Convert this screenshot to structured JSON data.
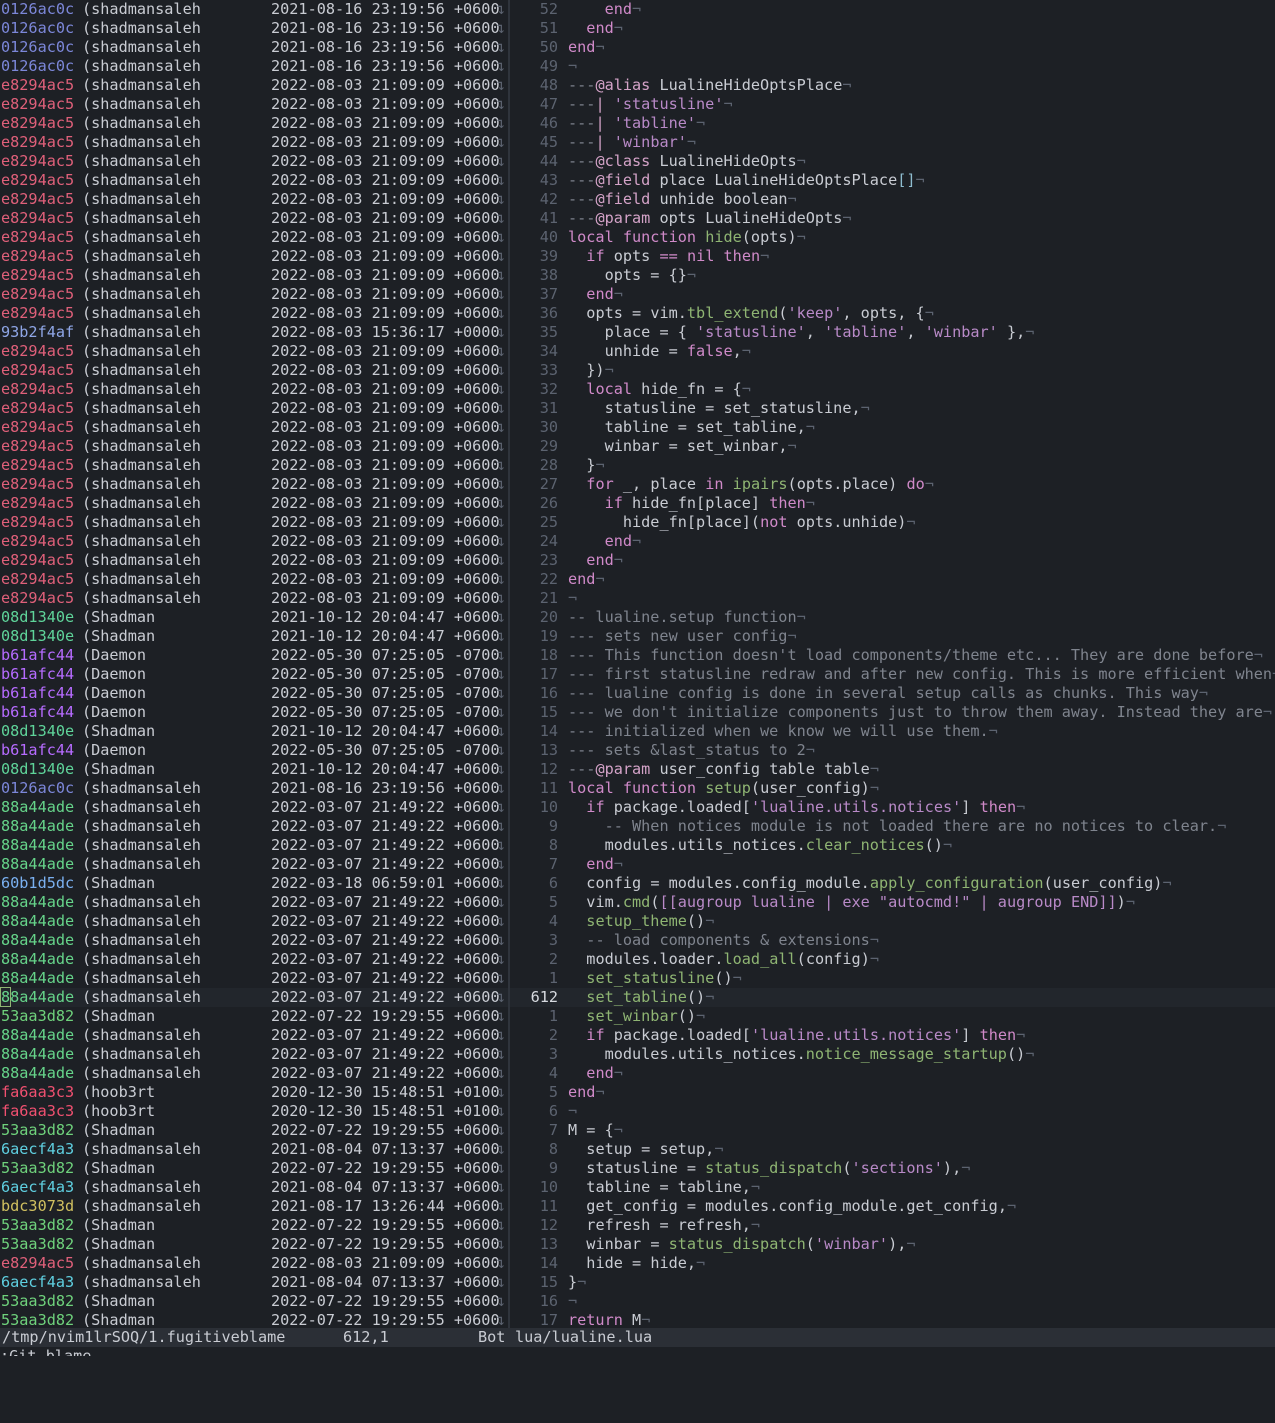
{
  "colors": {
    "hashes": {
      "0126ac0c": "#7c87d9",
      "e8294ac5": "#e0607a",
      "93b2f4af": "#8fa6e6",
      "08d1340e": "#5fd49a",
      "b61afc44": "#b66bff",
      "88a44ade": "#66d48a",
      "60b1d5dc": "#7ab0f0",
      "53aa3d82": "#6fd27c",
      "fa6aa3c3": "#f05070",
      "6aecf4a3": "#5fcfe0",
      "bdc3073d": "#d0c060"
    }
  },
  "blame_marker": "↴",
  "code_eol_marker": "¬",
  "blame_rows": [
    {
      "hash": "0126ac0c",
      "author": "(shadmansaleh",
      "date": "2021-08-16 23:19:56 +0600"
    },
    {
      "hash": "0126ac0c",
      "author": "(shadmansaleh",
      "date": "2021-08-16 23:19:56 +0600"
    },
    {
      "hash": "0126ac0c",
      "author": "(shadmansaleh",
      "date": "2021-08-16 23:19:56 +0600"
    },
    {
      "hash": "0126ac0c",
      "author": "(shadmansaleh",
      "date": "2021-08-16 23:19:56 +0600"
    },
    {
      "hash": "e8294ac5",
      "author": "(shadmansaleh",
      "date": "2022-08-03 21:09:09 +0600"
    },
    {
      "hash": "e8294ac5",
      "author": "(shadmansaleh",
      "date": "2022-08-03 21:09:09 +0600"
    },
    {
      "hash": "e8294ac5",
      "author": "(shadmansaleh",
      "date": "2022-08-03 21:09:09 +0600"
    },
    {
      "hash": "e8294ac5",
      "author": "(shadmansaleh",
      "date": "2022-08-03 21:09:09 +0600"
    },
    {
      "hash": "e8294ac5",
      "author": "(shadmansaleh",
      "date": "2022-08-03 21:09:09 +0600"
    },
    {
      "hash": "e8294ac5",
      "author": "(shadmansaleh",
      "date": "2022-08-03 21:09:09 +0600"
    },
    {
      "hash": "e8294ac5",
      "author": "(shadmansaleh",
      "date": "2022-08-03 21:09:09 +0600"
    },
    {
      "hash": "e8294ac5",
      "author": "(shadmansaleh",
      "date": "2022-08-03 21:09:09 +0600"
    },
    {
      "hash": "e8294ac5",
      "author": "(shadmansaleh",
      "date": "2022-08-03 21:09:09 +0600"
    },
    {
      "hash": "e8294ac5",
      "author": "(shadmansaleh",
      "date": "2022-08-03 21:09:09 +0600"
    },
    {
      "hash": "e8294ac5",
      "author": "(shadmansaleh",
      "date": "2022-08-03 21:09:09 +0600"
    },
    {
      "hash": "e8294ac5",
      "author": "(shadmansaleh",
      "date": "2022-08-03 21:09:09 +0600"
    },
    {
      "hash": "e8294ac5",
      "author": "(shadmansaleh",
      "date": "2022-08-03 21:09:09 +0600"
    },
    {
      "hash": "93b2f4af",
      "author": "(shadmansaleh",
      "date": "2022-08-03 15:36:17 +0000"
    },
    {
      "hash": "e8294ac5",
      "author": "(shadmansaleh",
      "date": "2022-08-03 21:09:09 +0600"
    },
    {
      "hash": "e8294ac5",
      "author": "(shadmansaleh",
      "date": "2022-08-03 21:09:09 +0600"
    },
    {
      "hash": "e8294ac5",
      "author": "(shadmansaleh",
      "date": "2022-08-03 21:09:09 +0600"
    },
    {
      "hash": "e8294ac5",
      "author": "(shadmansaleh",
      "date": "2022-08-03 21:09:09 +0600"
    },
    {
      "hash": "e8294ac5",
      "author": "(shadmansaleh",
      "date": "2022-08-03 21:09:09 +0600"
    },
    {
      "hash": "e8294ac5",
      "author": "(shadmansaleh",
      "date": "2022-08-03 21:09:09 +0600"
    },
    {
      "hash": "e8294ac5",
      "author": "(shadmansaleh",
      "date": "2022-08-03 21:09:09 +0600"
    },
    {
      "hash": "e8294ac5",
      "author": "(shadmansaleh",
      "date": "2022-08-03 21:09:09 +0600"
    },
    {
      "hash": "e8294ac5",
      "author": "(shadmansaleh",
      "date": "2022-08-03 21:09:09 +0600"
    },
    {
      "hash": "e8294ac5",
      "author": "(shadmansaleh",
      "date": "2022-08-03 21:09:09 +0600"
    },
    {
      "hash": "e8294ac5",
      "author": "(shadmansaleh",
      "date": "2022-08-03 21:09:09 +0600"
    },
    {
      "hash": "e8294ac5",
      "author": "(shadmansaleh",
      "date": "2022-08-03 21:09:09 +0600"
    },
    {
      "hash": "e8294ac5",
      "author": "(shadmansaleh",
      "date": "2022-08-03 21:09:09 +0600"
    },
    {
      "hash": "e8294ac5",
      "author": "(shadmansaleh",
      "date": "2022-08-03 21:09:09 +0600"
    },
    {
      "hash": "08d1340e",
      "author": "(Shadman",
      "date": "2021-10-12 20:04:47 +0600"
    },
    {
      "hash": "08d1340e",
      "author": "(Shadman",
      "date": "2021-10-12 20:04:47 +0600"
    },
    {
      "hash": "b61afc44",
      "author": "(Daemon",
      "date": "2022-05-30 07:25:05 -0700"
    },
    {
      "hash": "b61afc44",
      "author": "(Daemon",
      "date": "2022-05-30 07:25:05 -0700"
    },
    {
      "hash": "b61afc44",
      "author": "(Daemon",
      "date": "2022-05-30 07:25:05 -0700"
    },
    {
      "hash": "b61afc44",
      "author": "(Daemon",
      "date": "2022-05-30 07:25:05 -0700"
    },
    {
      "hash": "08d1340e",
      "author": "(Shadman",
      "date": "2021-10-12 20:04:47 +0600"
    },
    {
      "hash": "b61afc44",
      "author": "(Daemon",
      "date": "2022-05-30 07:25:05 -0700"
    },
    {
      "hash": "08d1340e",
      "author": "(Shadman",
      "date": "2021-10-12 20:04:47 +0600"
    },
    {
      "hash": "0126ac0c",
      "author": "(shadmansaleh",
      "date": "2021-08-16 23:19:56 +0600"
    },
    {
      "hash": "88a44ade",
      "author": "(shadmansaleh",
      "date": "2022-03-07 21:49:22 +0600"
    },
    {
      "hash": "88a44ade",
      "author": "(shadmansaleh",
      "date": "2022-03-07 21:49:22 +0600"
    },
    {
      "hash": "88a44ade",
      "author": "(shadmansaleh",
      "date": "2022-03-07 21:49:22 +0600"
    },
    {
      "hash": "88a44ade",
      "author": "(shadmansaleh",
      "date": "2022-03-07 21:49:22 +0600"
    },
    {
      "hash": "60b1d5dc",
      "author": "(Shadman",
      "date": "2022-03-18 06:59:01 +0600"
    },
    {
      "hash": "88a44ade",
      "author": "(shadmansaleh",
      "date": "2022-03-07 21:49:22 +0600"
    },
    {
      "hash": "88a44ade",
      "author": "(shadmansaleh",
      "date": "2022-03-07 21:49:22 +0600"
    },
    {
      "hash": "88a44ade",
      "author": "(shadmansaleh",
      "date": "2022-03-07 21:49:22 +0600"
    },
    {
      "hash": "88a44ade",
      "author": "(shadmansaleh",
      "date": "2022-03-07 21:49:22 +0600"
    },
    {
      "hash": "88a44ade",
      "author": "(shadmansaleh",
      "date": "2022-03-07 21:49:22 +0600"
    },
    {
      "hash": "88a44ade",
      "author": "(shadmansaleh",
      "date": "2022-03-07 21:49:22 +0600",
      "cursor": true
    },
    {
      "hash": "53aa3d82",
      "author": "(Shadman",
      "date": "2022-07-22 19:29:55 +0600"
    },
    {
      "hash": "88a44ade",
      "author": "(shadmansaleh",
      "date": "2022-03-07 21:49:22 +0600"
    },
    {
      "hash": "88a44ade",
      "author": "(shadmansaleh",
      "date": "2022-03-07 21:49:22 +0600"
    },
    {
      "hash": "88a44ade",
      "author": "(shadmansaleh",
      "date": "2022-03-07 21:49:22 +0600"
    },
    {
      "hash": "fa6aa3c3",
      "author": "(hoob3rt",
      "date": "2020-12-30 15:48:51 +0100"
    },
    {
      "hash": "fa6aa3c3",
      "author": "(hoob3rt",
      "date": "2020-12-30 15:48:51 +0100"
    },
    {
      "hash": "53aa3d82",
      "author": "(Shadman",
      "date": "2022-07-22 19:29:55 +0600"
    },
    {
      "hash": "6aecf4a3",
      "author": "(shadmansaleh",
      "date": "2021-08-04 07:13:37 +0600"
    },
    {
      "hash": "53aa3d82",
      "author": "(Shadman",
      "date": "2022-07-22 19:29:55 +0600"
    },
    {
      "hash": "6aecf4a3",
      "author": "(shadmansaleh",
      "date": "2021-08-04 07:13:37 +0600"
    },
    {
      "hash": "bdc3073d",
      "author": "(shadmansaleh",
      "date": "2021-08-17 13:26:44 +0600"
    },
    {
      "hash": "53aa3d82",
      "author": "(Shadman",
      "date": "2022-07-22 19:29:55 +0600"
    },
    {
      "hash": "53aa3d82",
      "author": "(Shadman",
      "date": "2022-07-22 19:29:55 +0600"
    },
    {
      "hash": "e8294ac5",
      "author": "(shadmansaleh",
      "date": "2022-08-03 21:09:09 +0600"
    },
    {
      "hash": "6aecf4a3",
      "author": "(shadmansaleh",
      "date": "2021-08-04 07:13:37 +0600"
    },
    {
      "hash": "53aa3d82",
      "author": "(Shadman",
      "date": "2022-07-22 19:29:55 +0600"
    },
    {
      "hash": "53aa3d82",
      "author": "(Shadman",
      "date": "2022-07-22 19:29:55 +0600"
    }
  ],
  "code_rows": [
    {
      "ln": "52",
      "text": "    end"
    },
    {
      "ln": "51",
      "text": "  end"
    },
    {
      "ln": "50",
      "text": "end"
    },
    {
      "ln": "49",
      "text": ""
    },
    {
      "ln": "48",
      "text": "---@alias LualineHideOptsPlace"
    },
    {
      "ln": "47",
      "text": "---| 'statusline'"
    },
    {
      "ln": "46",
      "text": "---| 'tabline'"
    },
    {
      "ln": "45",
      "text": "---| 'winbar'"
    },
    {
      "ln": "44",
      "text": "---@class LualineHideOpts"
    },
    {
      "ln": "43",
      "text": "---@field place LualineHideOptsPlace[]"
    },
    {
      "ln": "42",
      "text": "---@field unhide boolean"
    },
    {
      "ln": "41",
      "text": "---@param opts LualineHideOpts"
    },
    {
      "ln": "40",
      "text": "local function hide(opts)"
    },
    {
      "ln": "39",
      "text": "  if opts == nil then"
    },
    {
      "ln": "38",
      "text": "    opts = {}"
    },
    {
      "ln": "37",
      "text": "  end"
    },
    {
      "ln": "36",
      "text": "  opts = vim.tbl_extend('keep', opts, {"
    },
    {
      "ln": "35",
      "text": "    place = { 'statusline', 'tabline', 'winbar' },"
    },
    {
      "ln": "34",
      "text": "    unhide = false,"
    },
    {
      "ln": "33",
      "text": "  })"
    },
    {
      "ln": "32",
      "text": "  local hide_fn = {"
    },
    {
      "ln": "31",
      "text": "    statusline = set_statusline,"
    },
    {
      "ln": "30",
      "text": "    tabline = set_tabline,"
    },
    {
      "ln": "29",
      "text": "    winbar = set_winbar,"
    },
    {
      "ln": "28",
      "text": "  }"
    },
    {
      "ln": "27",
      "text": "  for _, place in ipairs(opts.place) do"
    },
    {
      "ln": "26",
      "text": "    if hide_fn[place] then"
    },
    {
      "ln": "25",
      "text": "      hide_fn[place](not opts.unhide)"
    },
    {
      "ln": "24",
      "text": "    end"
    },
    {
      "ln": "23",
      "text": "  end"
    },
    {
      "ln": "22",
      "text": "end"
    },
    {
      "ln": "21",
      "text": ""
    },
    {
      "ln": "20",
      "text": "-- lualine.setup function"
    },
    {
      "ln": "19",
      "text": "--- sets new user config"
    },
    {
      "ln": "18",
      "text": "--- This function doesn't load components/theme etc... They are done before"
    },
    {
      "ln": "17",
      "text": "--- first statusline redraw and after new config. This is more efficient when"
    },
    {
      "ln": "16",
      "text": "--- lualine config is done in several setup calls as chunks. This way"
    },
    {
      "ln": "15",
      "text": "--- we don't initialize components just to throw them away. Instead they are"
    },
    {
      "ln": "14",
      "text": "--- initialized when we know we will use them."
    },
    {
      "ln": "13",
      "text": "--- sets &last_status to 2"
    },
    {
      "ln": "12",
      "text": "---@param user_config table table"
    },
    {
      "ln": "11",
      "text": "local function setup(user_config)"
    },
    {
      "ln": "10",
      "text": "  if package.loaded['lualine.utils.notices'] then"
    },
    {
      "ln": "9",
      "text": "    -- When notices module is not loaded there are no notices to clear."
    },
    {
      "ln": "8",
      "text": "    modules.utils_notices.clear_notices()"
    },
    {
      "ln": "7",
      "text": "  end"
    },
    {
      "ln": "6",
      "text": "  config = modules.config_module.apply_configuration(user_config)"
    },
    {
      "ln": "5",
      "text": "  vim.cmd([[augroup lualine | exe \"autocmd!\" | augroup END]])"
    },
    {
      "ln": "4",
      "text": "  setup_theme()"
    },
    {
      "ln": "3",
      "text": "  -- load components & extensions"
    },
    {
      "ln": "2",
      "text": "  modules.loader.load_all(config)"
    },
    {
      "ln": "1",
      "text": "  set_statusline()"
    },
    {
      "ln": "612",
      "text": "  set_tabline()",
      "cursor": true
    },
    {
      "ln": "1",
      "text": "  set_winbar()"
    },
    {
      "ln": "2",
      "text": "  if package.loaded['lualine.utils.notices'] then"
    },
    {
      "ln": "3",
      "text": "    modules.utils_notices.notice_message_startup()"
    },
    {
      "ln": "4",
      "text": "  end"
    },
    {
      "ln": "5",
      "text": "end"
    },
    {
      "ln": "6",
      "text": ""
    },
    {
      "ln": "7",
      "text": "M = {"
    },
    {
      "ln": "8",
      "text": "  setup = setup,"
    },
    {
      "ln": "9",
      "text": "  statusline = status_dispatch('sections'),"
    },
    {
      "ln": "10",
      "text": "  tabline = tabline,"
    },
    {
      "ln": "11",
      "text": "  get_config = modules.config_module.get_config,"
    },
    {
      "ln": "12",
      "text": "  refresh = refresh,"
    },
    {
      "ln": "13",
      "text": "  winbar = status_dispatch('winbar'),"
    },
    {
      "ln": "14",
      "text": "  hide = hide,"
    },
    {
      "ln": "15",
      "text": "}"
    },
    {
      "ln": "16",
      "text": ""
    },
    {
      "ln": "17",
      "text": "return M"
    }
  ],
  "status": {
    "left_path": "/tmp/nvim1lrSOQ/1.fugitiveblame",
    "position": "612,1",
    "scroll": "Bot",
    "right_path": "lua/lualine.lua"
  },
  "cmdline": ":Git blame"
}
